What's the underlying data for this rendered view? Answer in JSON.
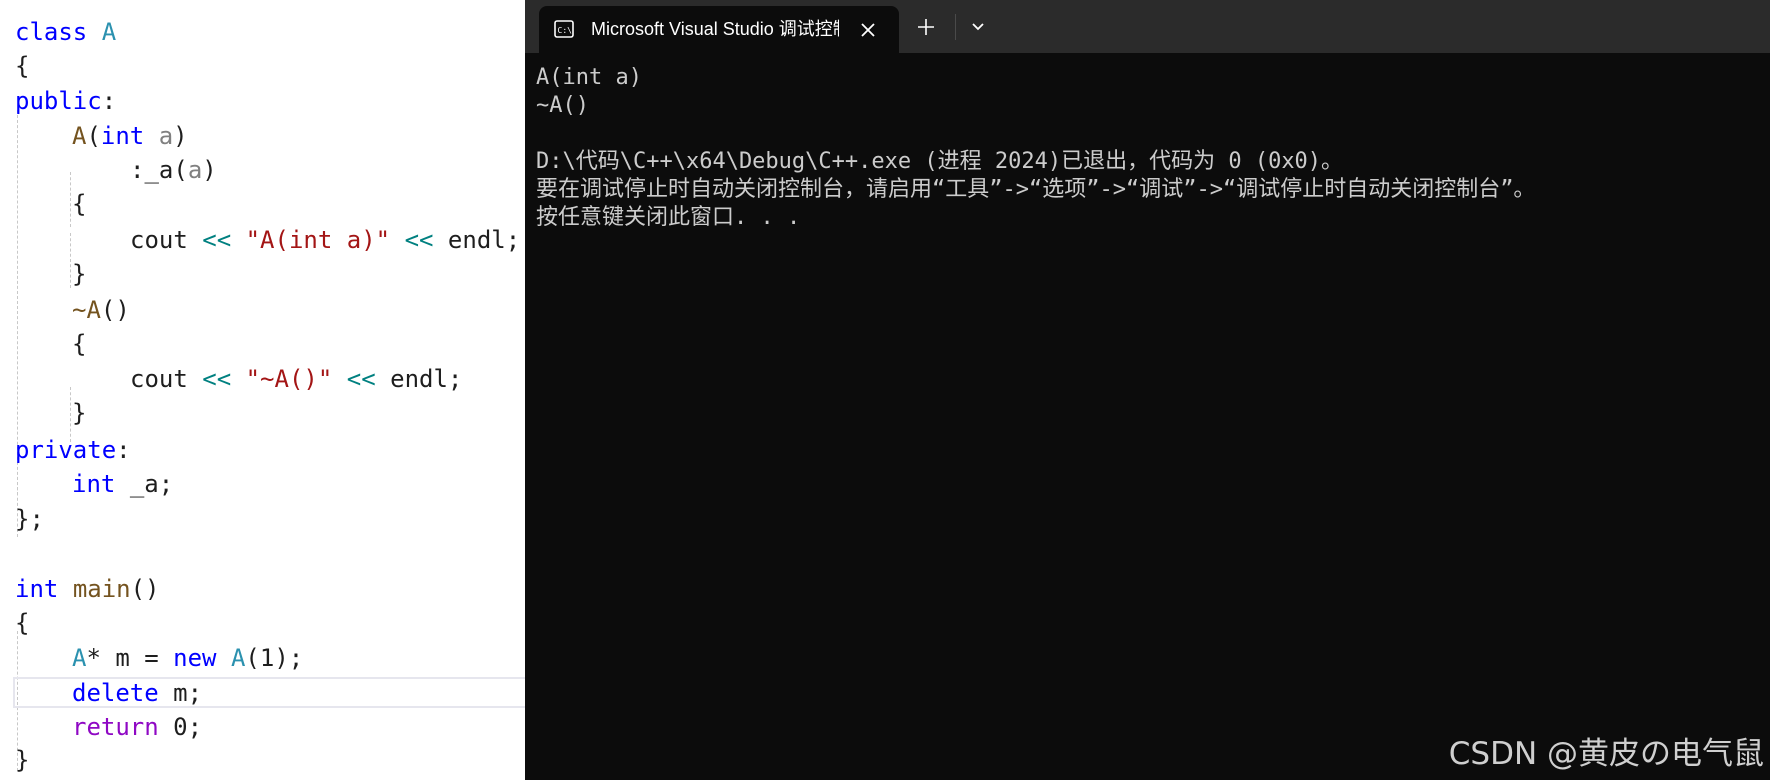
{
  "editor": {
    "code": {
      "class_kw": "class",
      "class_name": "A",
      "open_brace": "{",
      "close_brace": "}",
      "class_end": "};",
      "public_kw": "public",
      "private_kw": "private",
      "colon": ":",
      "ctor_name": "A",
      "int_kw": "int",
      "param_a": "a",
      "lparen": "(",
      "rparen": ")",
      "init_prefix": ":_a",
      "cout": "cout",
      "stream_op": "<<",
      "ctor_str": "\"A(int a)\"",
      "endl": "endl;",
      "tilde": "~",
      "dtor_name": "A",
      "parens": "()",
      "dtor_str": "\"~A()\"",
      "member": "_a;",
      "main_name": "main",
      "ptr_decl": "* m = ",
      "new_kw": "new",
      "num_one": "1",
      "stmt_end": ");",
      "delete_kw": "delete",
      "delete_arg": "m;",
      "return_kw": "return",
      "return_val": "0;"
    }
  },
  "terminal": {
    "tab_title": "Microsoft Visual Studio 调试控制台",
    "tab_icon": "terminal-icon",
    "close_icon": "close-icon",
    "new_tab_icon": "plus-icon",
    "dropdown_icon": "chevron-down-icon",
    "output_lines": [
      "A(int a)",
      "~A()",
      "",
      "D:\\代码\\C++\\x64\\Debug\\C++.exe (进程 2024)已退出，代码为 0 (0x0)。",
      "要在调试停止时自动关闭控制台，请启用“工具”->“选项”->“调试”->“调试停止时自动关闭控制台”。",
      "按任意键关闭此窗口. . ."
    ]
  },
  "watermark": "CSDN @黄皮の电气鼠",
  "colors": {
    "keyword": "#0000ff",
    "type": "#2b91af",
    "function": "#74531f",
    "string": "#a31515",
    "operator": "#008080",
    "parameter": "#808080",
    "control": "#8f08c4",
    "terminal_bg": "#0c0c0c",
    "titlebar_bg": "#2b2b2b",
    "terminal_text": "#cccccc"
  }
}
